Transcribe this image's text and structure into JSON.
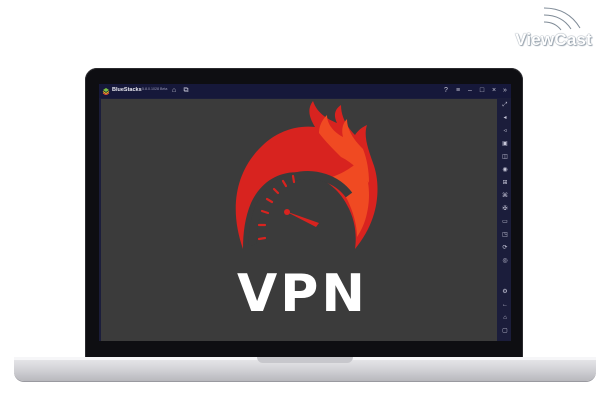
{
  "watermark": {
    "text": "ViewCast"
  },
  "window": {
    "app_name": "BlueStacks",
    "version": "5.8.0.1028 Beta",
    "title_icons": [
      "home-icon",
      "multi-instance-icon"
    ],
    "controls": [
      "help-icon",
      "menu-icon",
      "minimize-icon",
      "maximize-icon",
      "close-icon",
      "expand-icon"
    ]
  },
  "sidebar": {
    "icons": [
      "fullscreen-icon",
      "volume-up-icon",
      "volume-down-icon",
      "media-icon",
      "screenshot-icon",
      "record-icon",
      "install-apk-icon",
      "macro-icon",
      "gamepad-icon",
      "folder-icon",
      "shake-icon",
      "rotate-icon",
      "location-icon",
      "eco-mode-icon",
      "settings-icon",
      "back-icon",
      "home-icon",
      "recent-apps-icon"
    ]
  },
  "app_screen": {
    "logo_text": "VPN"
  },
  "colors": {
    "flame_red": "#d8231f",
    "flame_orange": "#f04a22",
    "screen_bg": "#3b3b3b",
    "bluestacks_frame": "#1b1d3b"
  }
}
